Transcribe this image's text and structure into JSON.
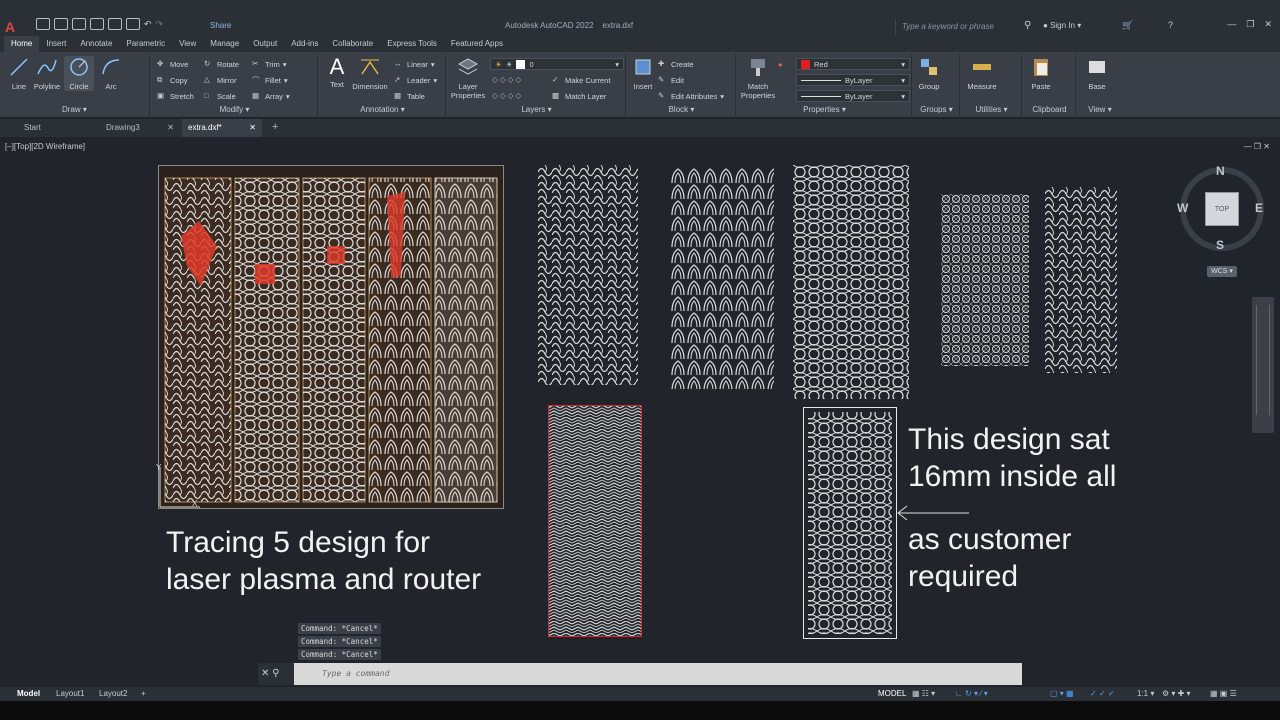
{
  "titlebar": {
    "share": "Share",
    "app_title": "Autodesk AutoCAD 2022",
    "file_title": "extra.dxf",
    "search_placeholder": "Type a keyword or phrase",
    "sign_in": "Sign In"
  },
  "ribbon_tabs": [
    "Home",
    "Insert",
    "Annotate",
    "Parametric",
    "View",
    "Manage",
    "Output",
    "Add-ins",
    "Collaborate",
    "Express Tools",
    "Featured Apps"
  ],
  "draw": {
    "title": "Draw",
    "line": "Line",
    "polyline": "Polyline",
    "circle": "Circle",
    "arc": "Arc"
  },
  "modify": {
    "title": "Modify",
    "move": "Move",
    "rotate": "Rotate",
    "trim": "Trim",
    "copy": "Copy",
    "mirror": "Mirror",
    "fillet": "Fillet",
    "stretch": "Stretch",
    "scale": "Scale",
    "array": "Array"
  },
  "annotation": {
    "title": "Annotation",
    "text": "Text",
    "dimension": "Dimension",
    "linear": "Linear",
    "leader": "Leader",
    "table": "Table"
  },
  "layers": {
    "title": "Layers",
    "layer_properties_1": "Layer",
    "layer_properties_2": "Properties",
    "current_layer": "0",
    "make_current": "Make Current",
    "match_layer": "Match Layer"
  },
  "block": {
    "title": "Block",
    "insert": "Insert",
    "create": "Create",
    "edit": "Edit",
    "edit_attributes": "Edit Attributes"
  },
  "properties": {
    "title": "Properties",
    "match_1": "Match",
    "match_2": "Properties",
    "color": "Red",
    "linetype": "ByLayer",
    "lineweight": "ByLayer"
  },
  "groups": {
    "title": "Groups",
    "group": "Group"
  },
  "utilities": {
    "title": "Utilities",
    "measure": "Measure"
  },
  "clipboard": {
    "title": "Clipboard",
    "paste": "Paste"
  },
  "view_panel": {
    "title": "View",
    "base": "Base"
  },
  "file_tabs": [
    "Start",
    "Drawing3",
    "extra.dxf*"
  ],
  "viewport": {
    "label": "[–][Top][2D Wireframe]",
    "compass": {
      "n": "N",
      "s": "S",
      "e": "E",
      "w": "W",
      "top": "TOP",
      "wcs": "WCS"
    },
    "annotations": {
      "left_line1": "Tracing 5 design for",
      "left_line2": "laser plasma and router",
      "right_line1": "This design sat",
      "right_line2": "16mm inside all",
      "right_line3": "as customer",
      "right_line4": "required"
    },
    "command_history": [
      "Command: *Cancel*",
      "Command: *Cancel*",
      "Command: *Cancel*"
    ],
    "command_placeholder": "Type a command"
  },
  "colors": {
    "red": "#d42a2a",
    "green": "#22b522",
    "cyan": "#20b8b8",
    "magenta": "#c733c7",
    "white": "#e6e6e6",
    "copper": "#c99a6a"
  },
  "status": {
    "model_tab": "Model",
    "layout1": "Layout1",
    "layout2": "Layout2",
    "model_space": "MODEL",
    "scale": "1:1"
  }
}
